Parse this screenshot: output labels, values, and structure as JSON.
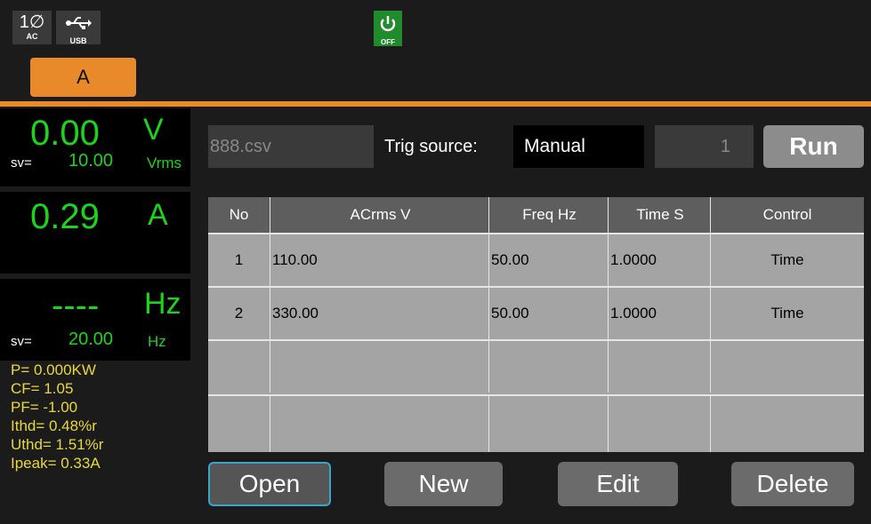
{
  "status_bar": {
    "phase_icon": {
      "main": "1∅",
      "sub": "AC"
    },
    "usb_icon": {
      "symbol": "⭠⭢",
      "sub": "USB"
    },
    "power_icon": {
      "symbol": "⏻",
      "label": "OFF"
    },
    "channel_tab": "A"
  },
  "measurements": {
    "voltage": {
      "value": "0.00",
      "unit": "V",
      "sv_label": "sv=",
      "sv_value": "10.00",
      "sv_unit": "Vrms"
    },
    "current": {
      "value": "0.29",
      "unit": "A"
    },
    "frequency": {
      "value": "----",
      "unit": "Hz",
      "sv_label": "sv=",
      "sv_value": "20.00",
      "sv_unit": "Hz"
    },
    "stats": [
      "P= 0.000KW",
      "CF= 1.05",
      "PF= -1.00",
      "Ithd= 0.48%r",
      "Uthd= 1.51%r",
      "Ipeak= 0.33A"
    ]
  },
  "controls": {
    "file_name": "888.csv",
    "trig_label": "Trig source:",
    "trig_value": "Manual",
    "count": "1",
    "run_label": "Run"
  },
  "table": {
    "headers": [
      "No",
      "ACrms V",
      "Freq Hz",
      "Time S",
      "Control"
    ],
    "rows": [
      [
        "1",
        "110.00",
        "50.00",
        "1.0000",
        "Time"
      ],
      [
        "2",
        "330.00",
        "50.00",
        "1.0000",
        "Time"
      ],
      [
        "",
        "",
        "",
        "",
        ""
      ],
      [
        "",
        "",
        "",
        "",
        ""
      ]
    ]
  },
  "buttons": {
    "open": "Open",
    "new": "New",
    "edit": "Edit",
    "delete": "Delete"
  },
  "colors": {
    "accent": "#e8892a",
    "measure_green": "#1bd41b",
    "stats_yellow": "#e8d838",
    "focus_border": "#37a6c8"
  }
}
